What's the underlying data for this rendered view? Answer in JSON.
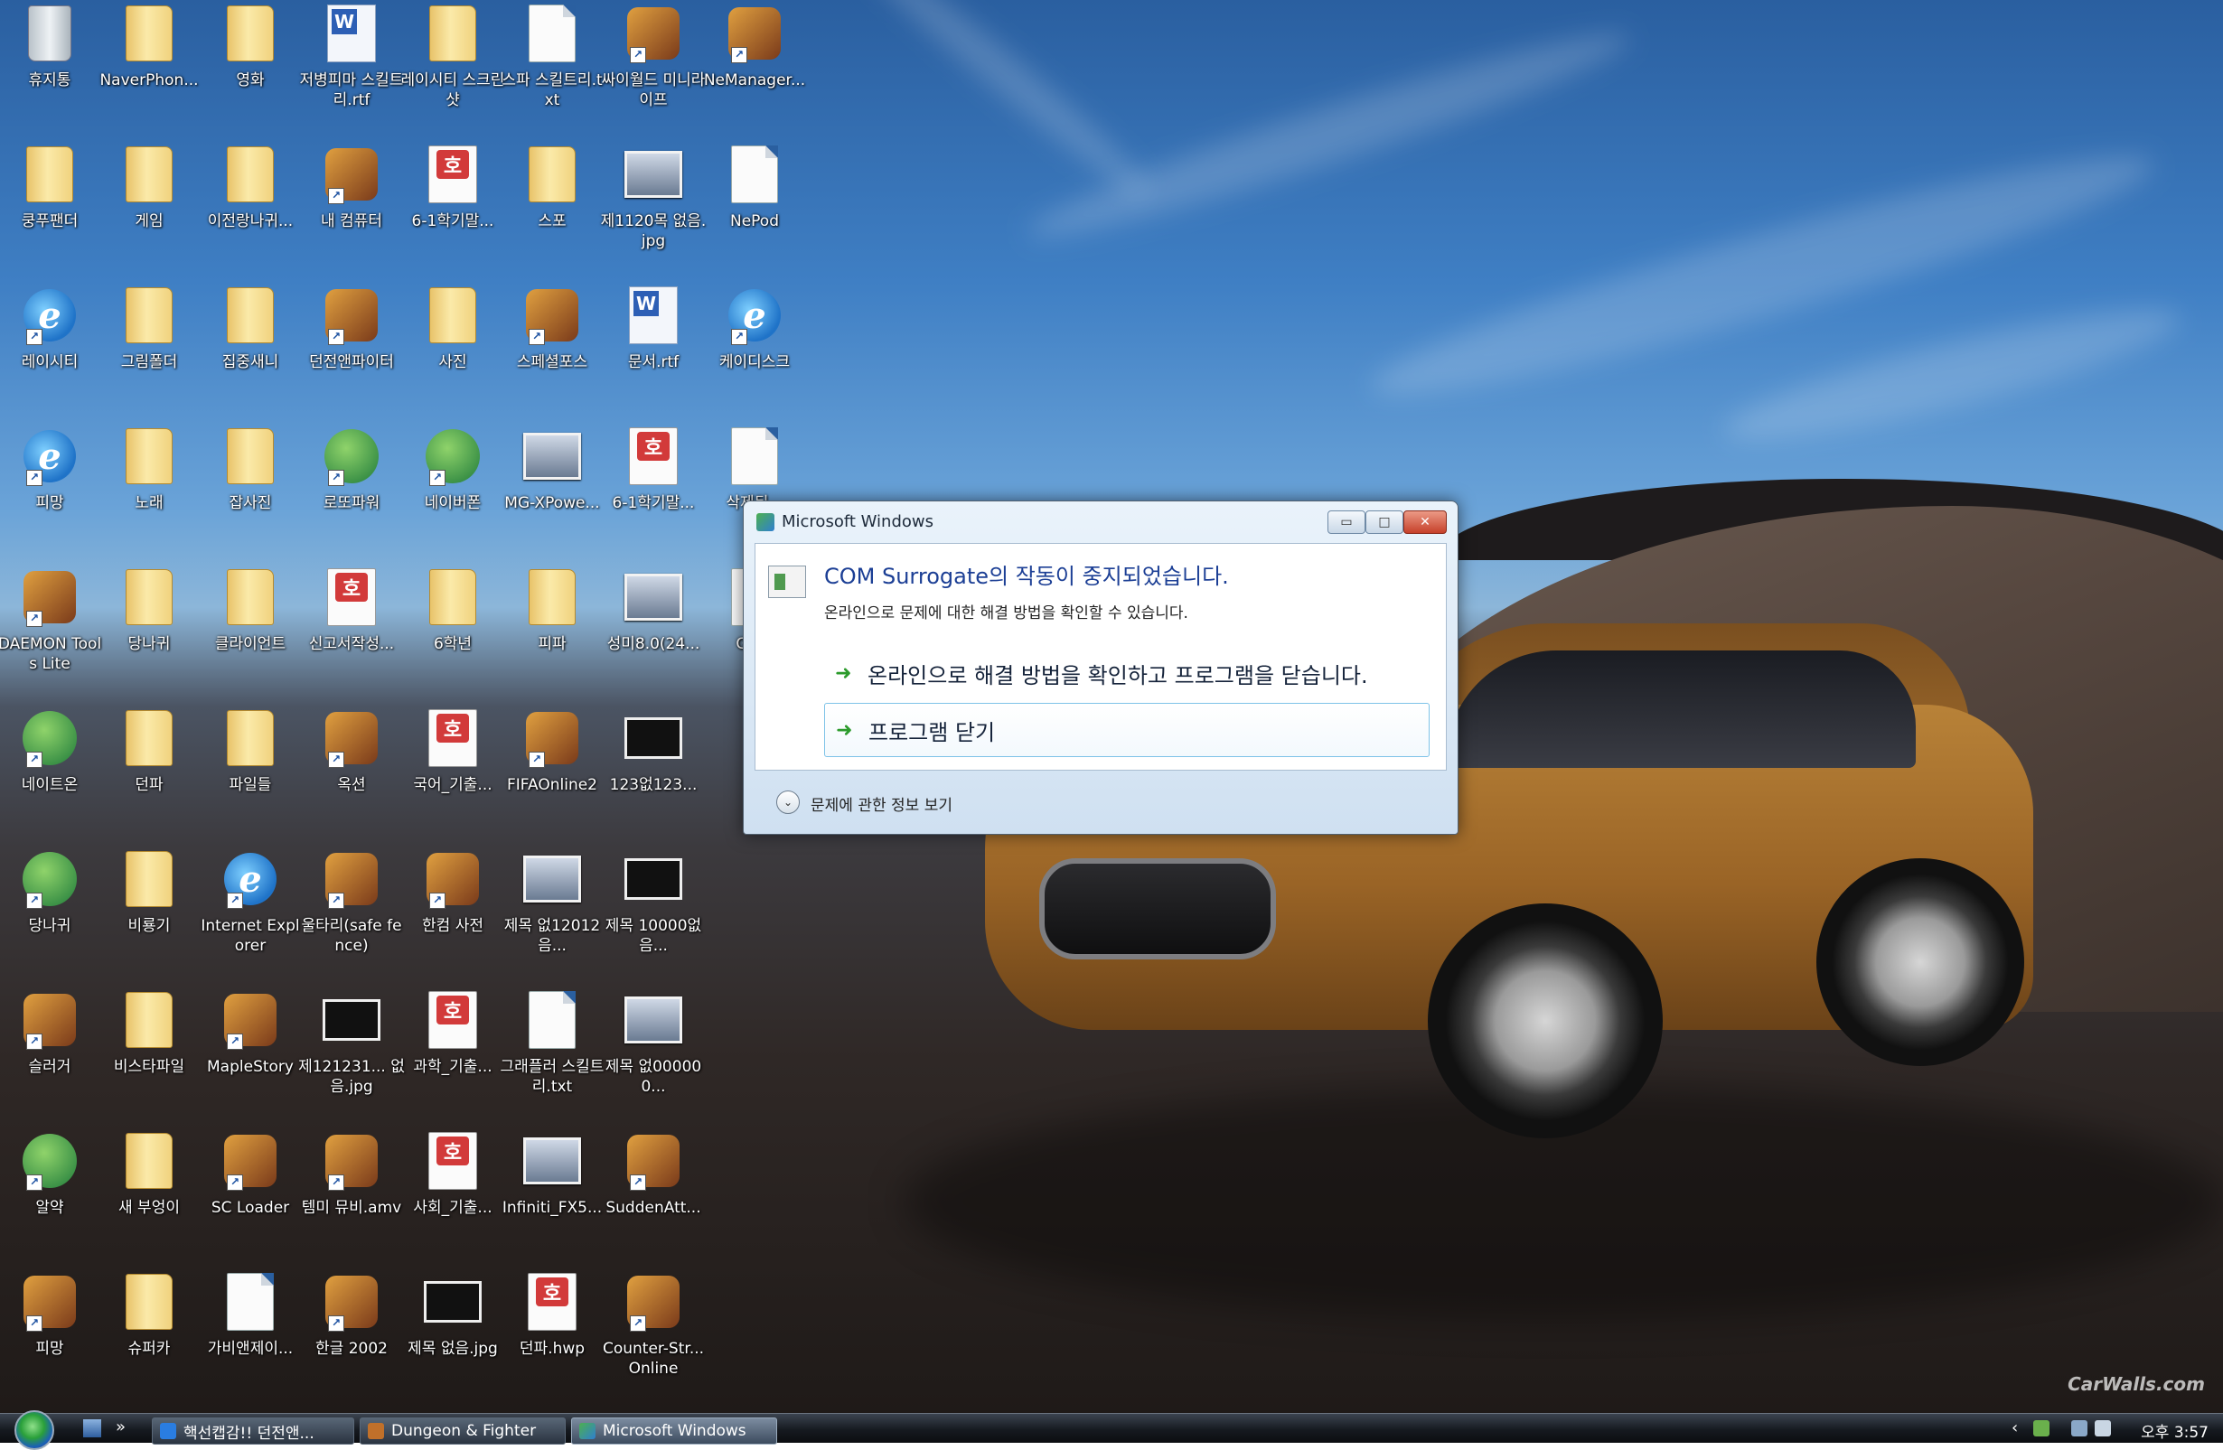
{
  "desktop": {
    "watermark": "CarWalls.com",
    "icons": [
      {
        "label": "휴지통",
        "type": "recycle"
      },
      {
        "label": "NaverPhon...",
        "type": "folder"
      },
      {
        "label": "영화",
        "type": "folder"
      },
      {
        "label": "저병피마 스킬트리.rtf",
        "type": "word"
      },
      {
        "label": "레이시티 스크린샷",
        "type": "folder"
      },
      {
        "label": "스파 스킬트리.txt",
        "type": "doc"
      },
      {
        "label": "싸이월드 미니라이프",
        "type": "app"
      },
      {
        "label": "NeManager...",
        "type": "app"
      },
      {
        "label": "쿵푸팬더",
        "type": "folder"
      },
      {
        "label": "게임",
        "type": "folder"
      },
      {
        "label": "이전랑나귀...",
        "type": "folder"
      },
      {
        "label": "내 컴퓨터",
        "type": "app"
      },
      {
        "label": "6-1학기말...",
        "type": "hwp"
      },
      {
        "label": "스포",
        "type": "folder"
      },
      {
        "label": "제1120목 없음.jpg",
        "type": "img"
      },
      {
        "label": "NePod",
        "type": "doc"
      },
      {
        "label": "레이시티",
        "type": "ie"
      },
      {
        "label": "그림폴더",
        "type": "folder"
      },
      {
        "label": "집중새니",
        "type": "folder"
      },
      {
        "label": "던전앤파이터",
        "type": "app"
      },
      {
        "label": "사진",
        "type": "folder"
      },
      {
        "label": "스페셜포스",
        "type": "app"
      },
      {
        "label": "문서.rtf",
        "type": "word"
      },
      {
        "label": "케이디스크",
        "type": "ie"
      },
      {
        "label": "피망",
        "type": "ie"
      },
      {
        "label": "노래",
        "type": "folder"
      },
      {
        "label": "잡사진",
        "type": "folder"
      },
      {
        "label": "로또파워",
        "type": "round"
      },
      {
        "label": "네이버폰",
        "type": "round"
      },
      {
        "label": "MG-XPowe...",
        "type": "img"
      },
      {
        "label": "6-1학기말...",
        "type": "hwp"
      },
      {
        "label": "삭제된...",
        "type": "doc"
      },
      {
        "label": "DAEMON Tools Lite",
        "type": "app"
      },
      {
        "label": "당나귀",
        "type": "folder"
      },
      {
        "label": "클라이언트",
        "type": "folder"
      },
      {
        "label": "신고서작성...",
        "type": "hwp"
      },
      {
        "label": "6학년",
        "type": "folder"
      },
      {
        "label": "피파",
        "type": "folder"
      },
      {
        "label": "성미8.0(24...",
        "type": "img"
      },
      {
        "label": "GOM",
        "type": "doc"
      },
      {
        "label": "네이트온",
        "type": "round"
      },
      {
        "label": "던파",
        "type": "folder"
      },
      {
        "label": "파일들",
        "type": "folder"
      },
      {
        "label": "옥션",
        "type": "app"
      },
      {
        "label": "국어_기출...",
        "type": "hwp"
      },
      {
        "label": "FIFAOnline2",
        "type": "app"
      },
      {
        "label": "123없123...",
        "type": "black"
      },
      {
        "label": "",
        "type": "none"
      },
      {
        "label": "당나귀",
        "type": "round"
      },
      {
        "label": "비룡기",
        "type": "folder"
      },
      {
        "label": "Internet Explorer",
        "type": "ie"
      },
      {
        "label": "울타리(safe fence)",
        "type": "app"
      },
      {
        "label": "한컴 사전",
        "type": "app"
      },
      {
        "label": "제목 없12012음...",
        "type": "img"
      },
      {
        "label": "제목 10000없음...",
        "type": "black"
      },
      {
        "label": "",
        "type": "none"
      },
      {
        "label": "슬러거",
        "type": "app"
      },
      {
        "label": "비스타파일",
        "type": "folder"
      },
      {
        "label": "MapleStory",
        "type": "app"
      },
      {
        "label": "제121231... 없음.jpg",
        "type": "black"
      },
      {
        "label": "과학_기출...",
        "type": "hwp"
      },
      {
        "label": "그래플러 스킬트리.txt",
        "type": "doc"
      },
      {
        "label": "제목 없000000...",
        "type": "img"
      },
      {
        "label": "",
        "type": "none"
      },
      {
        "label": "알약",
        "type": "round"
      },
      {
        "label": "새 부엉이",
        "type": "folder"
      },
      {
        "label": "SC Loader",
        "type": "app"
      },
      {
        "label": "템미 뮤비.amv",
        "type": "app"
      },
      {
        "label": "사회_기출...",
        "type": "hwp"
      },
      {
        "label": "Infiniti_FX5...",
        "type": "img"
      },
      {
        "label": "SuddenAtt...",
        "type": "app"
      },
      {
        "label": "",
        "type": "none"
      },
      {
        "label": "피망",
        "type": "app"
      },
      {
        "label": "슈퍼카",
        "type": "folder"
      },
      {
        "label": "가비앤제이...",
        "type": "doc"
      },
      {
        "label": "한글 2002",
        "type": "app"
      },
      {
        "label": "제목 없음.jpg",
        "type": "black"
      },
      {
        "label": "던파.hwp",
        "type": "hwp"
      },
      {
        "label": "Counter-Str... Online",
        "type": "app"
      },
      {
        "label": "",
        "type": "none"
      }
    ]
  },
  "dialog": {
    "title": "Microsoft Windows",
    "main_instruction": "COM Surrogate의 작동이 중지되었습니다.",
    "sub_instruction": "온라인으로 문제에 대한 해결 방법을 확인할 수 있습니다.",
    "option_online": "온라인으로 해결 방법을 확인하고 프로그램을 닫습니다.",
    "option_close": "프로그램 닫기",
    "details": "문제에 관한 정보 보기",
    "btn_minimize": "▭",
    "btn_maximize": "□",
    "btn_close": "✕"
  },
  "taskbar": {
    "quicklaunch_more": "»",
    "buttons": [
      {
        "label": "핵선캡감!! 던전앤...",
        "active": false
      },
      {
        "label": "Dungeon & Fighter",
        "active": false
      },
      {
        "label": "Microsoft Windows",
        "active": true
      }
    ],
    "tray_chevron": "‹",
    "clock": "오후 3:57"
  }
}
